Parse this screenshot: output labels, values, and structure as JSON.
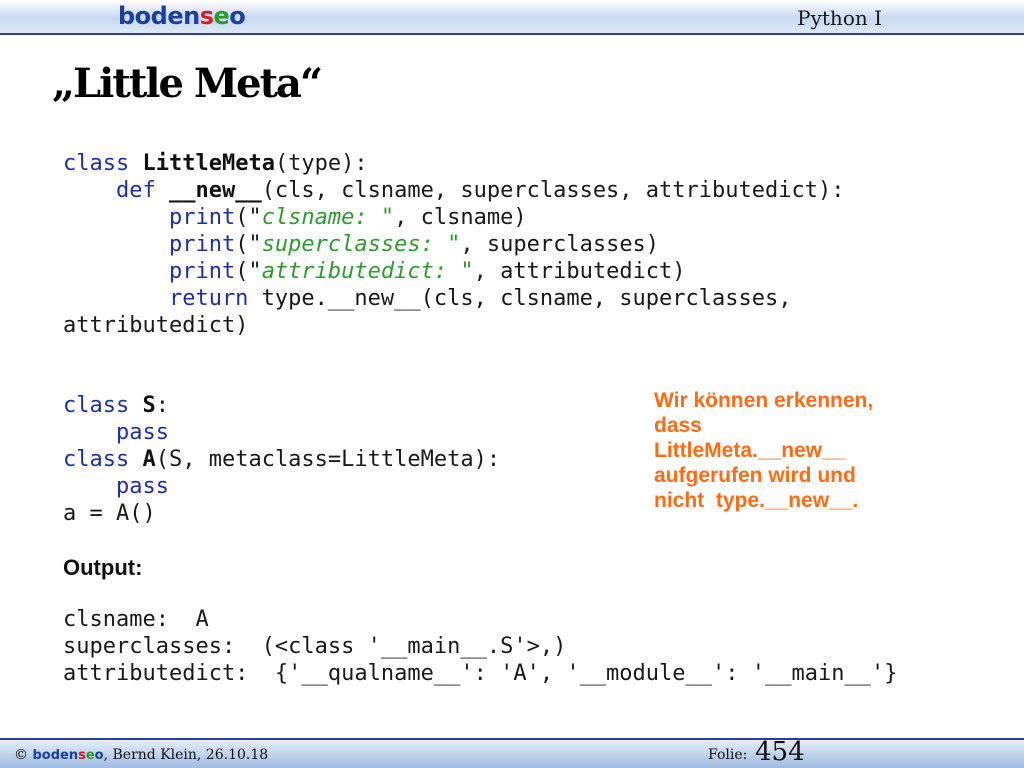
{
  "header": {
    "logo": {
      "part1": "boden",
      "part2": "s",
      "part3": "e",
      "part4": "o"
    },
    "course": "Python I"
  },
  "slide": {
    "title": "„Little Meta“"
  },
  "code_block1": [
    [
      "class ",
      "LittleMeta",
      "(type):"
    ],
    [
      "    def ",
      "__new__",
      "(cls, clsname, superclasses, attributedict):"
    ],
    [
      "        print",
      "(\"",
      "clsname: ",
      "\"",
      ", clsname)"
    ],
    [
      "        print",
      "(\"",
      "superclasses: ",
      "\"",
      ", superclasses)"
    ],
    [
      "        print",
      "(\"",
      "attributedict: ",
      "\"",
      ", attributedict)"
    ],
    [
      "        return",
      " type.__new__(cls, clsname, superclasses,"
    ],
    [
      "attributedict)"
    ]
  ],
  "code_block2": [
    [
      "class ",
      "S",
      ":"
    ],
    [
      "    pass"
    ],
    [
      "class ",
      "A",
      "(S, metaclass=LittleMeta):"
    ],
    [
      "    pass"
    ],
    [
      "a = A()"
    ]
  ],
  "output_label": "Output:",
  "output_lines": [
    "clsname:  A",
    "superclasses:  (<class '__main__.S'>,)",
    "attributedict:  {'__qualname__': 'A', '__module__': '__main__'}"
  ],
  "note_lines": [
    "Wir können erkennen,",
    "dass",
    "LittleMeta.__new__",
    "aufgerufen wird und",
    "nicht  type.__new__."
  ],
  "footer": {
    "copyright": "©",
    "logo": {
      "part1": "boden",
      "part2": "s",
      "part3": "e",
      "part4": "o"
    },
    "author_date": ", Bernd Klein, 26.10.18",
    "folie_label": "Folie:",
    "page_number": "454"
  },
  "colors": {
    "keyword": "#1f2fa8",
    "string": "#2d9c2d",
    "note": "#ff6a13",
    "logo_blue": "#1f3f9f",
    "logo_red": "#d62020",
    "logo_green": "#2a9a2a"
  }
}
